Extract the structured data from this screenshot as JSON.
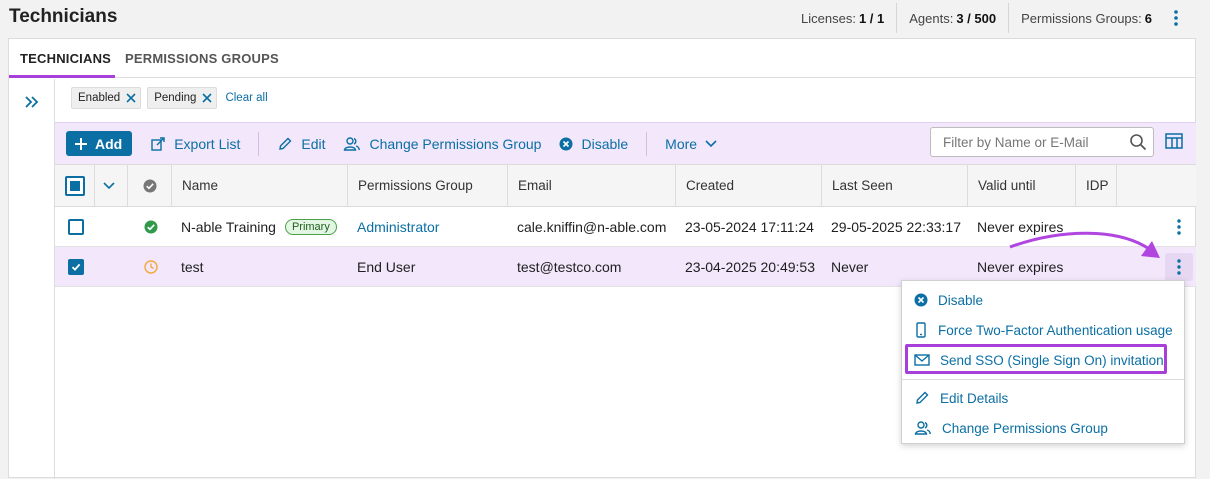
{
  "header": {
    "title": "Technicians",
    "licenses_label": "Licenses:",
    "licenses_value": "1 / 1",
    "agents_label": "Agents:",
    "agents_value": "3 / 500",
    "groups_label": "Permissions Groups:",
    "groups_value": "6"
  },
  "tabs": [
    {
      "label": "TECHNICIANS"
    },
    {
      "label": "PERMISSIONS GROUPS"
    }
  ],
  "filters": {
    "chips": [
      "Enabled",
      "Pending"
    ],
    "clear_label": "Clear all"
  },
  "toolbar": {
    "add": "Add",
    "export": "Export List",
    "edit": "Edit",
    "change_group": "Change Permissions Group",
    "disable": "Disable",
    "more": "More",
    "search_placeholder": "Filter by Name or E-Mail"
  },
  "table": {
    "columns": [
      "Name",
      "Permissions Group",
      "Email",
      "Created",
      "Last Seen",
      "Valid until",
      "IDP"
    ],
    "rows": [
      {
        "name": "N-able Training",
        "badge": "Primary",
        "group": "Administrator",
        "email": "cale.kniffin@n-able.com",
        "created": "23-05-2024 17:11:24",
        "last_seen": "29-05-2025 22:33:17",
        "valid_until": "Never expires",
        "idp": ""
      },
      {
        "name": "test",
        "badge": "",
        "group": "End User",
        "email": "test@testco.com",
        "created": "23-04-2025 20:49:53",
        "last_seen": "Never",
        "valid_until": "Never expires",
        "idp": ""
      }
    ]
  },
  "context_menu": {
    "items": [
      "Disable",
      "Force Two-Factor Authentication usage",
      "Send SSO (Single Sign On) invitation",
      "Edit Details",
      "Change Permissions Group"
    ]
  },
  "colors": {
    "accent": "#0b6fa4",
    "highlight": "#a83fd8",
    "selected_row": "#f3e7fb",
    "status_ok": "#2e9a4a",
    "status_pending": "#f2a93b"
  },
  "icons": {
    "kebab": "kebab-vertical-icon",
    "expand": "double-chevron-right-icon",
    "remove": "x-icon",
    "add": "plus-icon",
    "export": "export-icon",
    "edit": "pencil-icon",
    "group": "users-icon",
    "disable": "x-circle-icon",
    "chevron": "chevron-down-icon",
    "search": "search-icon",
    "columns": "columns-icon",
    "status_col": "check-circle-icon",
    "enabled": "check-circle-filled-icon",
    "pending": "clock-icon",
    "phone": "phone-icon",
    "mail": "mail-icon"
  }
}
